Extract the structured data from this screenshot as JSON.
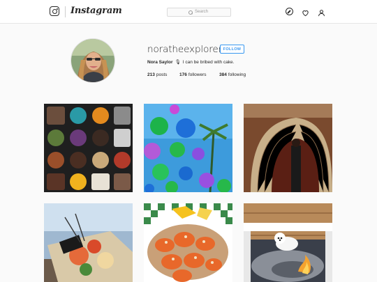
{
  "nav": {
    "wordmark": "Instagram",
    "search_placeholder": "Search",
    "icons": [
      "instagram-glyph-icon",
      "compass-icon",
      "heart-icon",
      "user-icon"
    ]
  },
  "profile": {
    "username": "noratheexplorer",
    "follow_label": "FOLLOW",
    "full_name": "Nora Saylor",
    "bio_emoji": "🎙",
    "bio_text": "I can be bribed with cake.",
    "stats": {
      "posts_count": "213",
      "posts_label": "posts",
      "followers_count": "176",
      "followers_label": "followers",
      "following_count": "384",
      "following_label": "following"
    }
  },
  "posts": [
    {
      "subject": "chocolate bonbons"
    },
    {
      "subject": "balloons and palm trees"
    },
    {
      "subject": "book tunnel"
    },
    {
      "subject": "seafood platter"
    },
    {
      "subject": "shrimp dish"
    },
    {
      "subject": "white dog on fire pit"
    }
  ],
  "colors": {
    "accent": "#3897f0",
    "text": "#262626",
    "border": "#dbdbdb",
    "background": "#fafafa"
  }
}
